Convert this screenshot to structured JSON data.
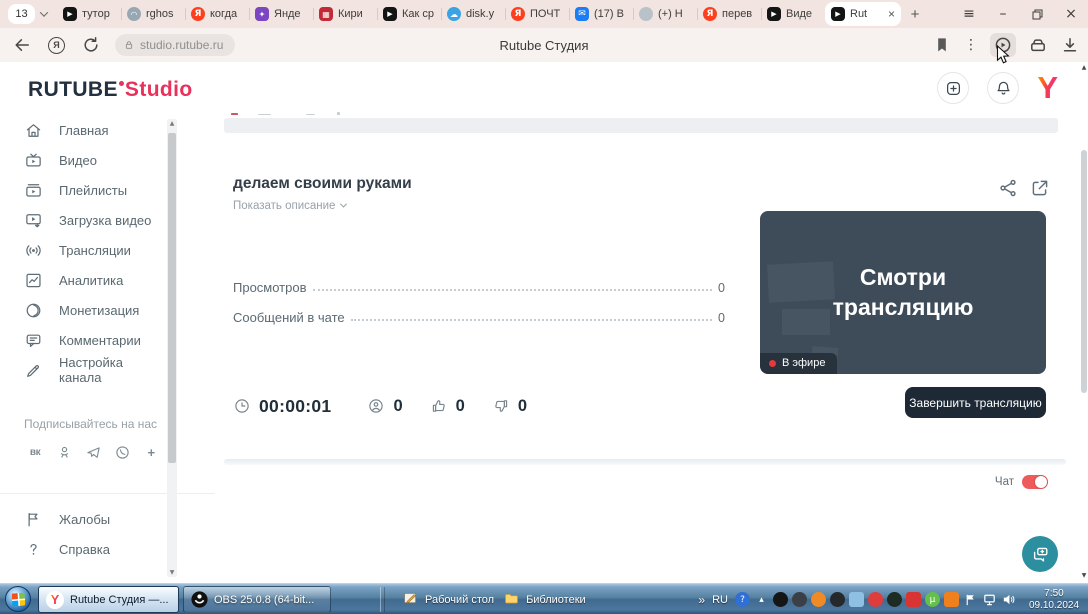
{
  "colors": {
    "accent": "#e8315b",
    "tabbar-bg": "#f2e4e0",
    "addressbar-bg": "#f7f2f0",
    "preview-bg": "#3e4b59",
    "dark-button": "#1d2935",
    "toggle-red": "#ef5a5a",
    "live-dot": "#e8373d",
    "teal": "#2b8fa0"
  },
  "browser": {
    "tab_count": "13",
    "tabs": [
      {
        "label": "тутор",
        "icon": "rutube"
      },
      {
        "label": "rghos",
        "icon": "ghost"
      },
      {
        "label": "когда",
        "icon": "yandex"
      },
      {
        "label": "Янде",
        "icon": "yagames"
      },
      {
        "label": "Кири",
        "icon": "redapp"
      },
      {
        "label": "Как ср",
        "icon": "rutube"
      },
      {
        "label": "disk.y",
        "icon": "cloud"
      },
      {
        "label": "ПОЧТ",
        "icon": "yandex"
      },
      {
        "label": "(17) В",
        "icon": "mail"
      },
      {
        "label": "(+) Н",
        "icon": "greyapp"
      },
      {
        "label": "перев",
        "icon": "yandex"
      },
      {
        "label": "Виде",
        "icon": "rutube"
      },
      {
        "label": "Rut",
        "icon": "rutube",
        "active": true
      }
    ],
    "new_tab_label": "+",
    "window_controls": {
      "menu": "≡",
      "minimize": "–",
      "close": "×"
    },
    "nav": {
      "url": "studio.rutube.ru",
      "page_title": "Rutube Студия"
    }
  },
  "studio": {
    "logo_primary": "RUTUBE",
    "logo_secondary": "Studio",
    "sidebar": {
      "items": [
        {
          "label": "Главная",
          "icon": "home-icon"
        },
        {
          "label": "Видео",
          "icon": "tv-icon"
        },
        {
          "label": "Плейлисты",
          "icon": "playlist-icon"
        },
        {
          "label": "Загрузка видео",
          "icon": "upload-icon"
        },
        {
          "label": "Трансляции",
          "icon": "broadcast-icon"
        },
        {
          "label": "Аналитика",
          "icon": "analytics-icon"
        },
        {
          "label": "Монетизация",
          "icon": "coin-icon"
        },
        {
          "label": "Комментарии",
          "icon": "comments-icon"
        },
        {
          "label": "Настройка канала",
          "icon": "pen-icon"
        }
      ],
      "subscribe_label": "Подписывайтесь на нас",
      "social_icons": [
        "vk-icon",
        "ok-icon",
        "telegram-icon",
        "viber-icon",
        "more-icon"
      ],
      "footer_items": [
        {
          "label": "Жалобы",
          "icon": "flag-icon"
        },
        {
          "label": "Справка",
          "icon": "help-icon"
        }
      ]
    },
    "stream": {
      "title": "делаем своими руками",
      "show_description_label": "Показать описание",
      "stat_rows": [
        {
          "label": "Просмотров",
          "value": "0"
        },
        {
          "label": "Сообщений в чате",
          "value": "0"
        }
      ],
      "preview_text": "Смотри трансляцию",
      "live_badge": "В эфире",
      "counters": {
        "duration": "00:00:01",
        "viewers": "0",
        "likes": "0",
        "dislikes": "0"
      },
      "end_button_label": "Завершить трансляцию",
      "chat_label": "Чат"
    }
  },
  "taskbar": {
    "apps": [
      {
        "label": "Rutube Студия —...",
        "icon": "ybrowser-icon",
        "active": true
      },
      {
        "label": "OBS 25.0.8 (64-bit...",
        "icon": "obs-icon",
        "active": false
      }
    ],
    "toolbar": [
      {
        "label": "Рабочий стол",
        "icon": "desktop-icon"
      },
      {
        "label": "Библиотеки",
        "icon": "folder-icon"
      }
    ],
    "tray": {
      "overflow": "»",
      "language": "RU",
      "icons": [
        {
          "name": "help-tray-icon",
          "bg": "#2f6fd6",
          "glyph": "?"
        },
        {
          "name": "expand-tray-icon",
          "bg": "none",
          "glyph": "▴"
        },
        {
          "name": "obs-tray-icon",
          "bg": "#151515"
        },
        {
          "name": "mixer-tray-icon",
          "bg": "#3a4046"
        },
        {
          "name": "fan-tray-icon",
          "bg": "#f08a24"
        },
        {
          "name": "dot-tray-icon",
          "bg": "#26292c"
        },
        {
          "name": "preview-tray-icon",
          "bg": "#8fc0e4",
          "square": true
        },
        {
          "name": "alert-tray-icon",
          "bg": "#e03c3c"
        },
        {
          "name": "nvo-tray-icon",
          "bg": "#1d2b22"
        },
        {
          "name": "camera-tray-icon",
          "bg": "#d93434",
          "square": true
        },
        {
          "name": "utorrent-tray-icon",
          "bg": "#66bf4a",
          "glyph": "µ"
        },
        {
          "name": "agent-tray-icon",
          "bg": "#f07f1d",
          "square": true
        },
        {
          "name": "flag-tray-icon",
          "bg": "none",
          "svg": "flag"
        },
        {
          "name": "network-tray-icon",
          "bg": "none",
          "svg": "network"
        },
        {
          "name": "volume-tray-icon",
          "bg": "none",
          "svg": "volume"
        }
      ],
      "time": "7:50",
      "date": "09.10.2024"
    }
  }
}
